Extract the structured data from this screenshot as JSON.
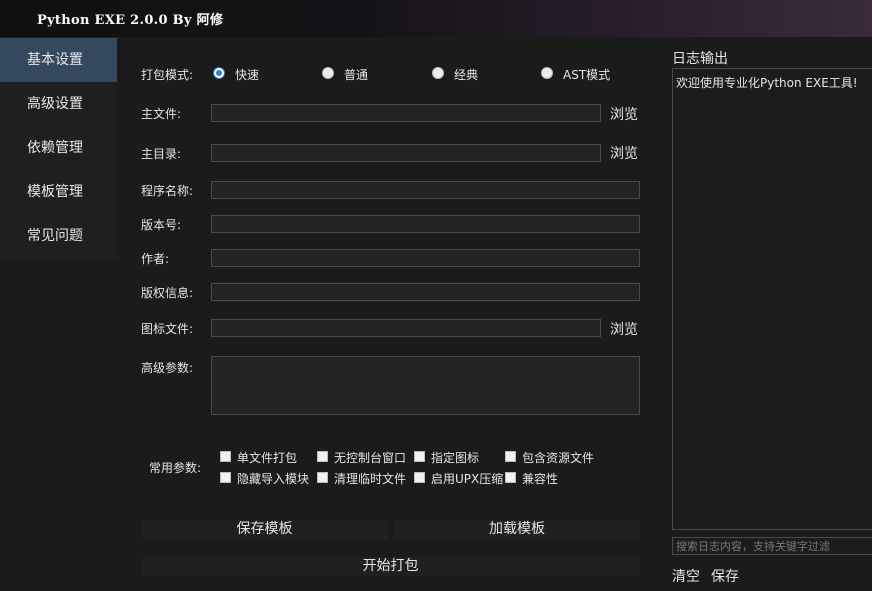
{
  "window": {
    "title": "Python EXE 2.0.0 By 阿修"
  },
  "sidebar": {
    "items": [
      {
        "label": "基本设置",
        "active": true
      },
      {
        "label": "高级设置"
      },
      {
        "label": "依赖管理"
      },
      {
        "label": "模板管理"
      },
      {
        "label": "常见问题"
      }
    ]
  },
  "form": {
    "pack_mode": {
      "label": "打包模式:",
      "options": [
        {
          "label": "快速",
          "checked": true
        },
        {
          "label": "普通",
          "checked": false
        },
        {
          "label": "经典",
          "checked": false
        },
        {
          "label": "AST模式",
          "checked": false
        }
      ]
    },
    "main_file": {
      "label": "主文件:",
      "value": ""
    },
    "main_dir": {
      "label": "主目录:",
      "value": ""
    },
    "program_name": {
      "label": "程序名称:",
      "value": ""
    },
    "version": {
      "label": "版本号:",
      "value": ""
    },
    "author": {
      "label": "作者:",
      "value": ""
    },
    "copyright": {
      "label": "版权信息:",
      "value": ""
    },
    "icon_file": {
      "label": "图标文件:",
      "value": ""
    },
    "advanced_params": {
      "label": "高级参数:",
      "value": ""
    },
    "browse_label": "浏览",
    "common_params": {
      "label": "常用参数:",
      "options": [
        {
          "label": "单文件打包",
          "checked": false
        },
        {
          "label": "无控制台窗口",
          "checked": false
        },
        {
          "label": "指定图标",
          "checked": false
        },
        {
          "label": "包含资源文件",
          "checked": false
        },
        {
          "label": "隐藏导入模块",
          "checked": false
        },
        {
          "label": "清理临时文件",
          "checked": false
        },
        {
          "label": "启用UPX压缩",
          "checked": false
        },
        {
          "label": "兼容性",
          "checked": false
        }
      ]
    }
  },
  "buttons": {
    "save_template": "保存模板",
    "load_template": "加载模板",
    "start_pack": "开始打包"
  },
  "log": {
    "title": "日志输出",
    "content": "欢迎使用专业化Python EXE工具!",
    "search_placeholder": "搜索日志内容，支持关键字过滤",
    "clear_label": "清空",
    "save_label": "保存"
  },
  "colors": {
    "accent": "#2d7fd4",
    "sidebar_active": "#34495e",
    "background": "#1b1b1b",
    "field_border": "#4a4a4a"
  }
}
